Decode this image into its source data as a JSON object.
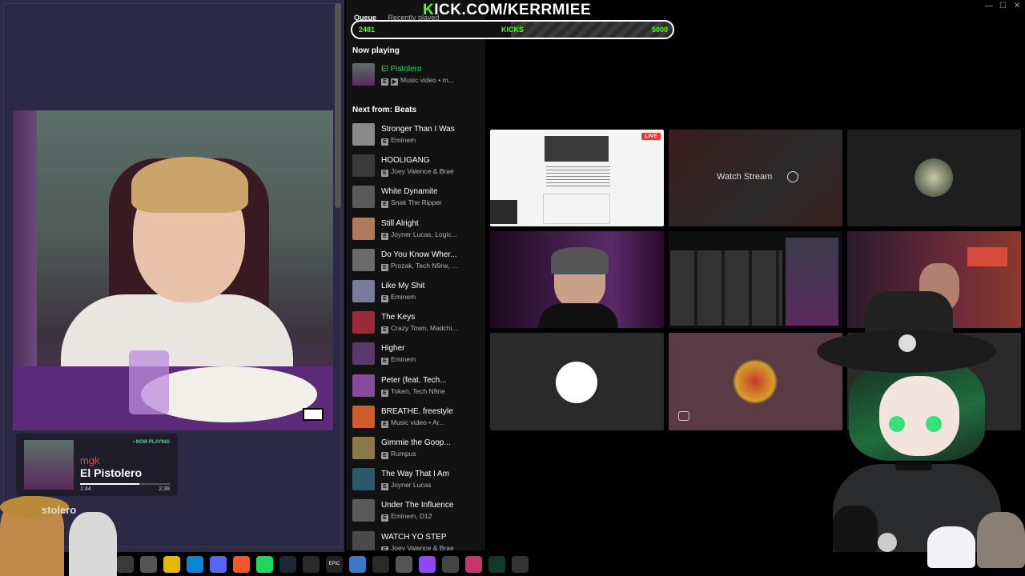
{
  "overlay": {
    "kick_prefix": "K",
    "kick_rest": "ICK.COM/KERRMIEE",
    "goal_current": "2481",
    "goal_label": "KICKS",
    "goal_max": "5000",
    "goal_progress": 0.4962
  },
  "now_playing_card": {
    "badge": "• NOW PLAYING",
    "artist": "mgk",
    "title": "El Pistolero",
    "time_elapsed": "1:44",
    "time_total": "2:38",
    "progress": 0.658
  },
  "left_footer_text": "stolero",
  "queue": {
    "tabs": [
      "Queue",
      "Recently played"
    ],
    "now_playing_heading": "Now playing",
    "now_playing": {
      "title": "El Pistolero",
      "sub": "Music video • m..."
    },
    "next_heading": "Next from: Beats",
    "items": [
      {
        "title": "Stronger Than I Was",
        "sub": "Eminem",
        "color": "#8a8a8a"
      },
      {
        "title": "HOOLIGANG",
        "sub": "Joey Valence & Brae",
        "color": "#3a3a3a"
      },
      {
        "title": "White Dynamite",
        "sub": "Snak The Ripper",
        "color": "#5a5a5a"
      },
      {
        "title": "Still Alright",
        "sub": "Joyner Lucas, Logic...",
        "color": "#b07a5a"
      },
      {
        "title": "Do You Know Wher...",
        "sub": "Prozak, Tech N9ne, ...",
        "color": "#6a6a6a"
      },
      {
        "title": "Like My Shit",
        "sub": "Eminem",
        "color": "#7a7a9a"
      },
      {
        "title": "The Keys",
        "sub": "Crazy Town, Madchi...",
        "color": "#9a2a3a"
      },
      {
        "title": "Higher",
        "sub": "Eminem",
        "color": "#5a3a6a"
      },
      {
        "title": "Peter (feat. Tech...",
        "sub": "Token, Tech N9ne",
        "color": "#8a4a9a"
      },
      {
        "title": "BREATHE. freestyle",
        "sub": "Music video • Ar...",
        "color": "#d05a2a"
      },
      {
        "title": "Gimmie the Goop...",
        "sub": "Rumpus",
        "color": "#8a7a4a"
      },
      {
        "title": "The Way That I Am",
        "sub": "Joyner Lucas",
        "color": "#2a5a6a"
      },
      {
        "title": "Under The Influence",
        "sub": "Eminem, D12",
        "color": "#5a5a5a"
      },
      {
        "title": "WATCH YO STEP",
        "sub": "Joey Valence & Brae",
        "color": "#4a4a4a"
      }
    ]
  },
  "streams": {
    "live_badge": "LIVE",
    "watch_label": "Watch Stream"
  },
  "window_controls": {
    "minimize": "—",
    "maximize": "☐",
    "close": "✕"
  },
  "taskbar": {
    "icons": [
      "chrome-icon",
      "file-icon",
      "folder-icon",
      "edge-icon",
      "discord-icon",
      "brave-icon",
      "spotify-icon",
      "steam-icon",
      "obs-icon",
      "epic-icon",
      "notepad-icon",
      "calculator-icon",
      "chat-icon",
      "twitch-icon",
      "settings-icon",
      "vtuber-icon",
      "terminal-icon",
      "steelseries-icon"
    ],
    "epic_text": "EPIC"
  },
  "colors": {
    "kick_green": "#53fc18",
    "spotify_green": "#1ed760",
    "live_red": "#e53935"
  }
}
